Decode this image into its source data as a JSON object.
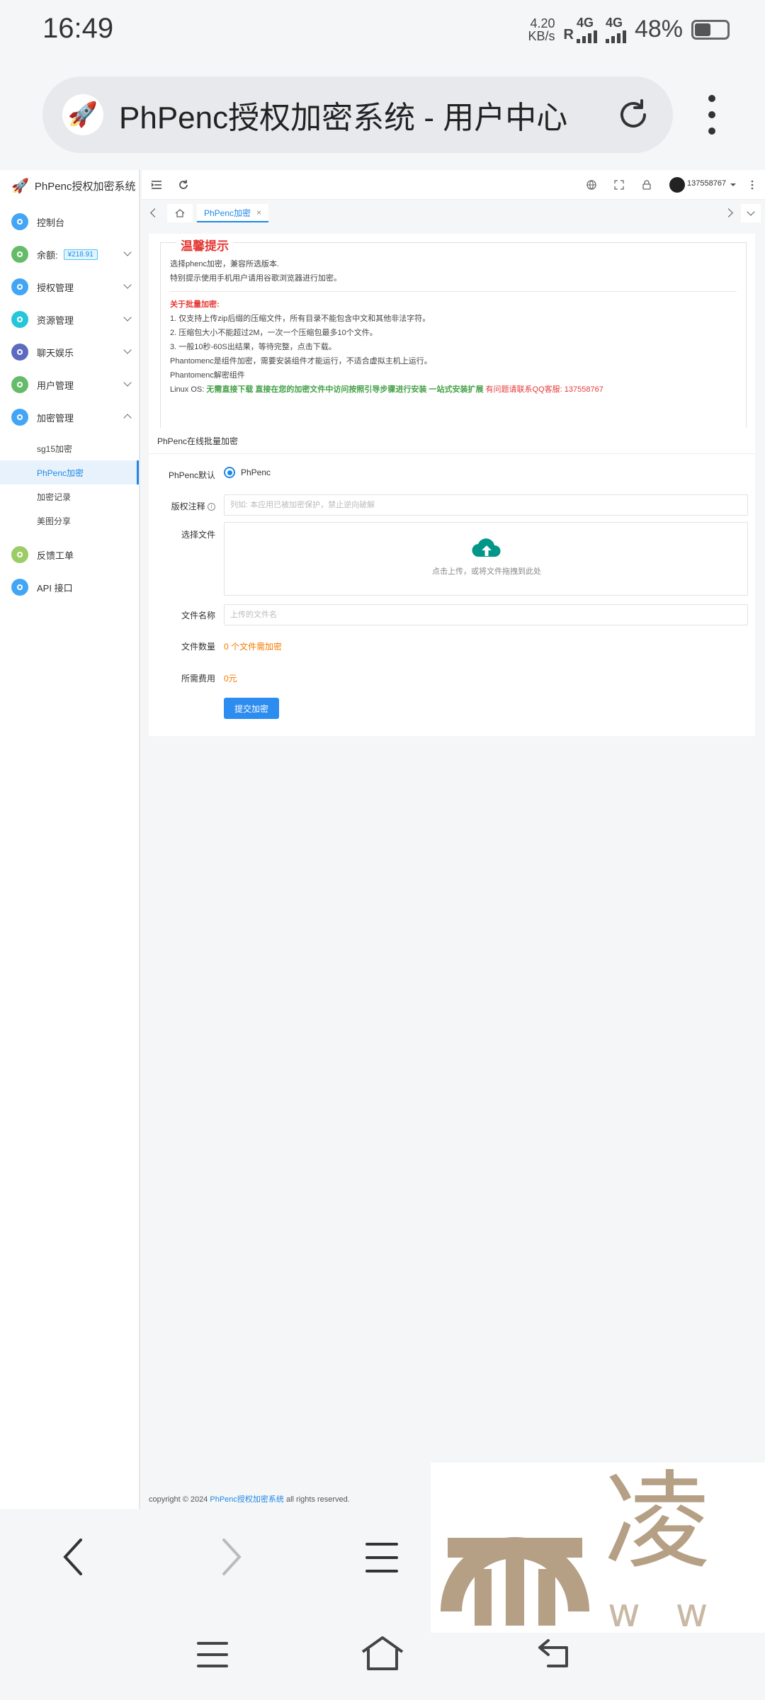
{
  "status_bar": {
    "time": "16:49",
    "net_speed_value": "4.20",
    "net_speed_unit": "KB/s",
    "roaming": "R",
    "net1": "4G",
    "net2": "4G",
    "battery": "48%"
  },
  "browser": {
    "page_title": "PhPenc授权加密系统 - 用户中心"
  },
  "sidebar": {
    "app_name": "PhPenc授权加密系统",
    "items": [
      {
        "label": "控制台",
        "color": "#42a5f5"
      },
      {
        "label": "余额:",
        "badge": "¥218.91",
        "color": "#66bb6a"
      },
      {
        "label": "授权管理",
        "color": "#42a5f5"
      },
      {
        "label": "资源管理",
        "color": "#26c6da"
      },
      {
        "label": "聊天娱乐",
        "color": "#5c6bc0"
      },
      {
        "label": "用户管理",
        "color": "#66bb6a"
      },
      {
        "label": "加密管理",
        "color": "#42a5f5"
      }
    ],
    "sub_items": [
      "sg15加密",
      "PhPenc加密",
      "加密记录",
      "美图分享"
    ],
    "items_after": [
      {
        "label": "反馈工单",
        "color": "#9ccc65"
      },
      {
        "label": "API 接口",
        "color": "#42a5f5"
      }
    ]
  },
  "topbar": {
    "user": "137558767"
  },
  "tabs": {
    "active": "PhPenc加密",
    "close": "×"
  },
  "notice": {
    "legend": "温馨提示",
    "line1": "选择phenc加密，兼容所选版本.",
    "line2": "特别提示使用手机用户请用谷歌浏览器进行加密。",
    "batch_title": "关于批量加密:",
    "item1": "1. 仅支持上传zip后缀的压缩文件，所有目录不能包含中文和其他非法字符。",
    "item2": "2. 压缩包大小不能超过2M，一次一个压缩包最多10个文件。",
    "item3": "3. 一般10秒-60S出结果，等待完整，点击下载。",
    "item4": "Phantomenc是组件加密，需要安装组件才能运行，不适合虚拟主机上运行。",
    "item5": "Phantomenc解密组件",
    "linux_label": "Linux OS: ",
    "linux_green": "无需直接下载 直接在您的加密文件中访问按照引导步骤进行安装 一站式安装扩展",
    "linux_red": " 有问题请联系QQ客服: 137558767"
  },
  "form": {
    "title": "PhPenc在线批量加密",
    "default_label": "PhPenc默认",
    "default_option": "PhPenc",
    "copyright_label": "版权注释",
    "copyright_placeholder": "列如: 本应用已被加密保护，禁止逆向破解",
    "file_label": "选择文件",
    "upload_hint": "点击上传，或将文件拖拽到此处",
    "filename_label": "文件名称",
    "filename_placeholder": "上传的文件名",
    "count_label": "文件数量",
    "count_value": "0 个文件需加密",
    "fee_label": "所需费用",
    "fee_value": "0元",
    "submit": "提交加密"
  },
  "footer": {
    "prefix": "copyright © 2024 ",
    "link": "PhPenc授权加密系统",
    "suffix": " all rights reserved."
  },
  "watermark": {
    "char": "凌",
    "www": "w w w"
  }
}
